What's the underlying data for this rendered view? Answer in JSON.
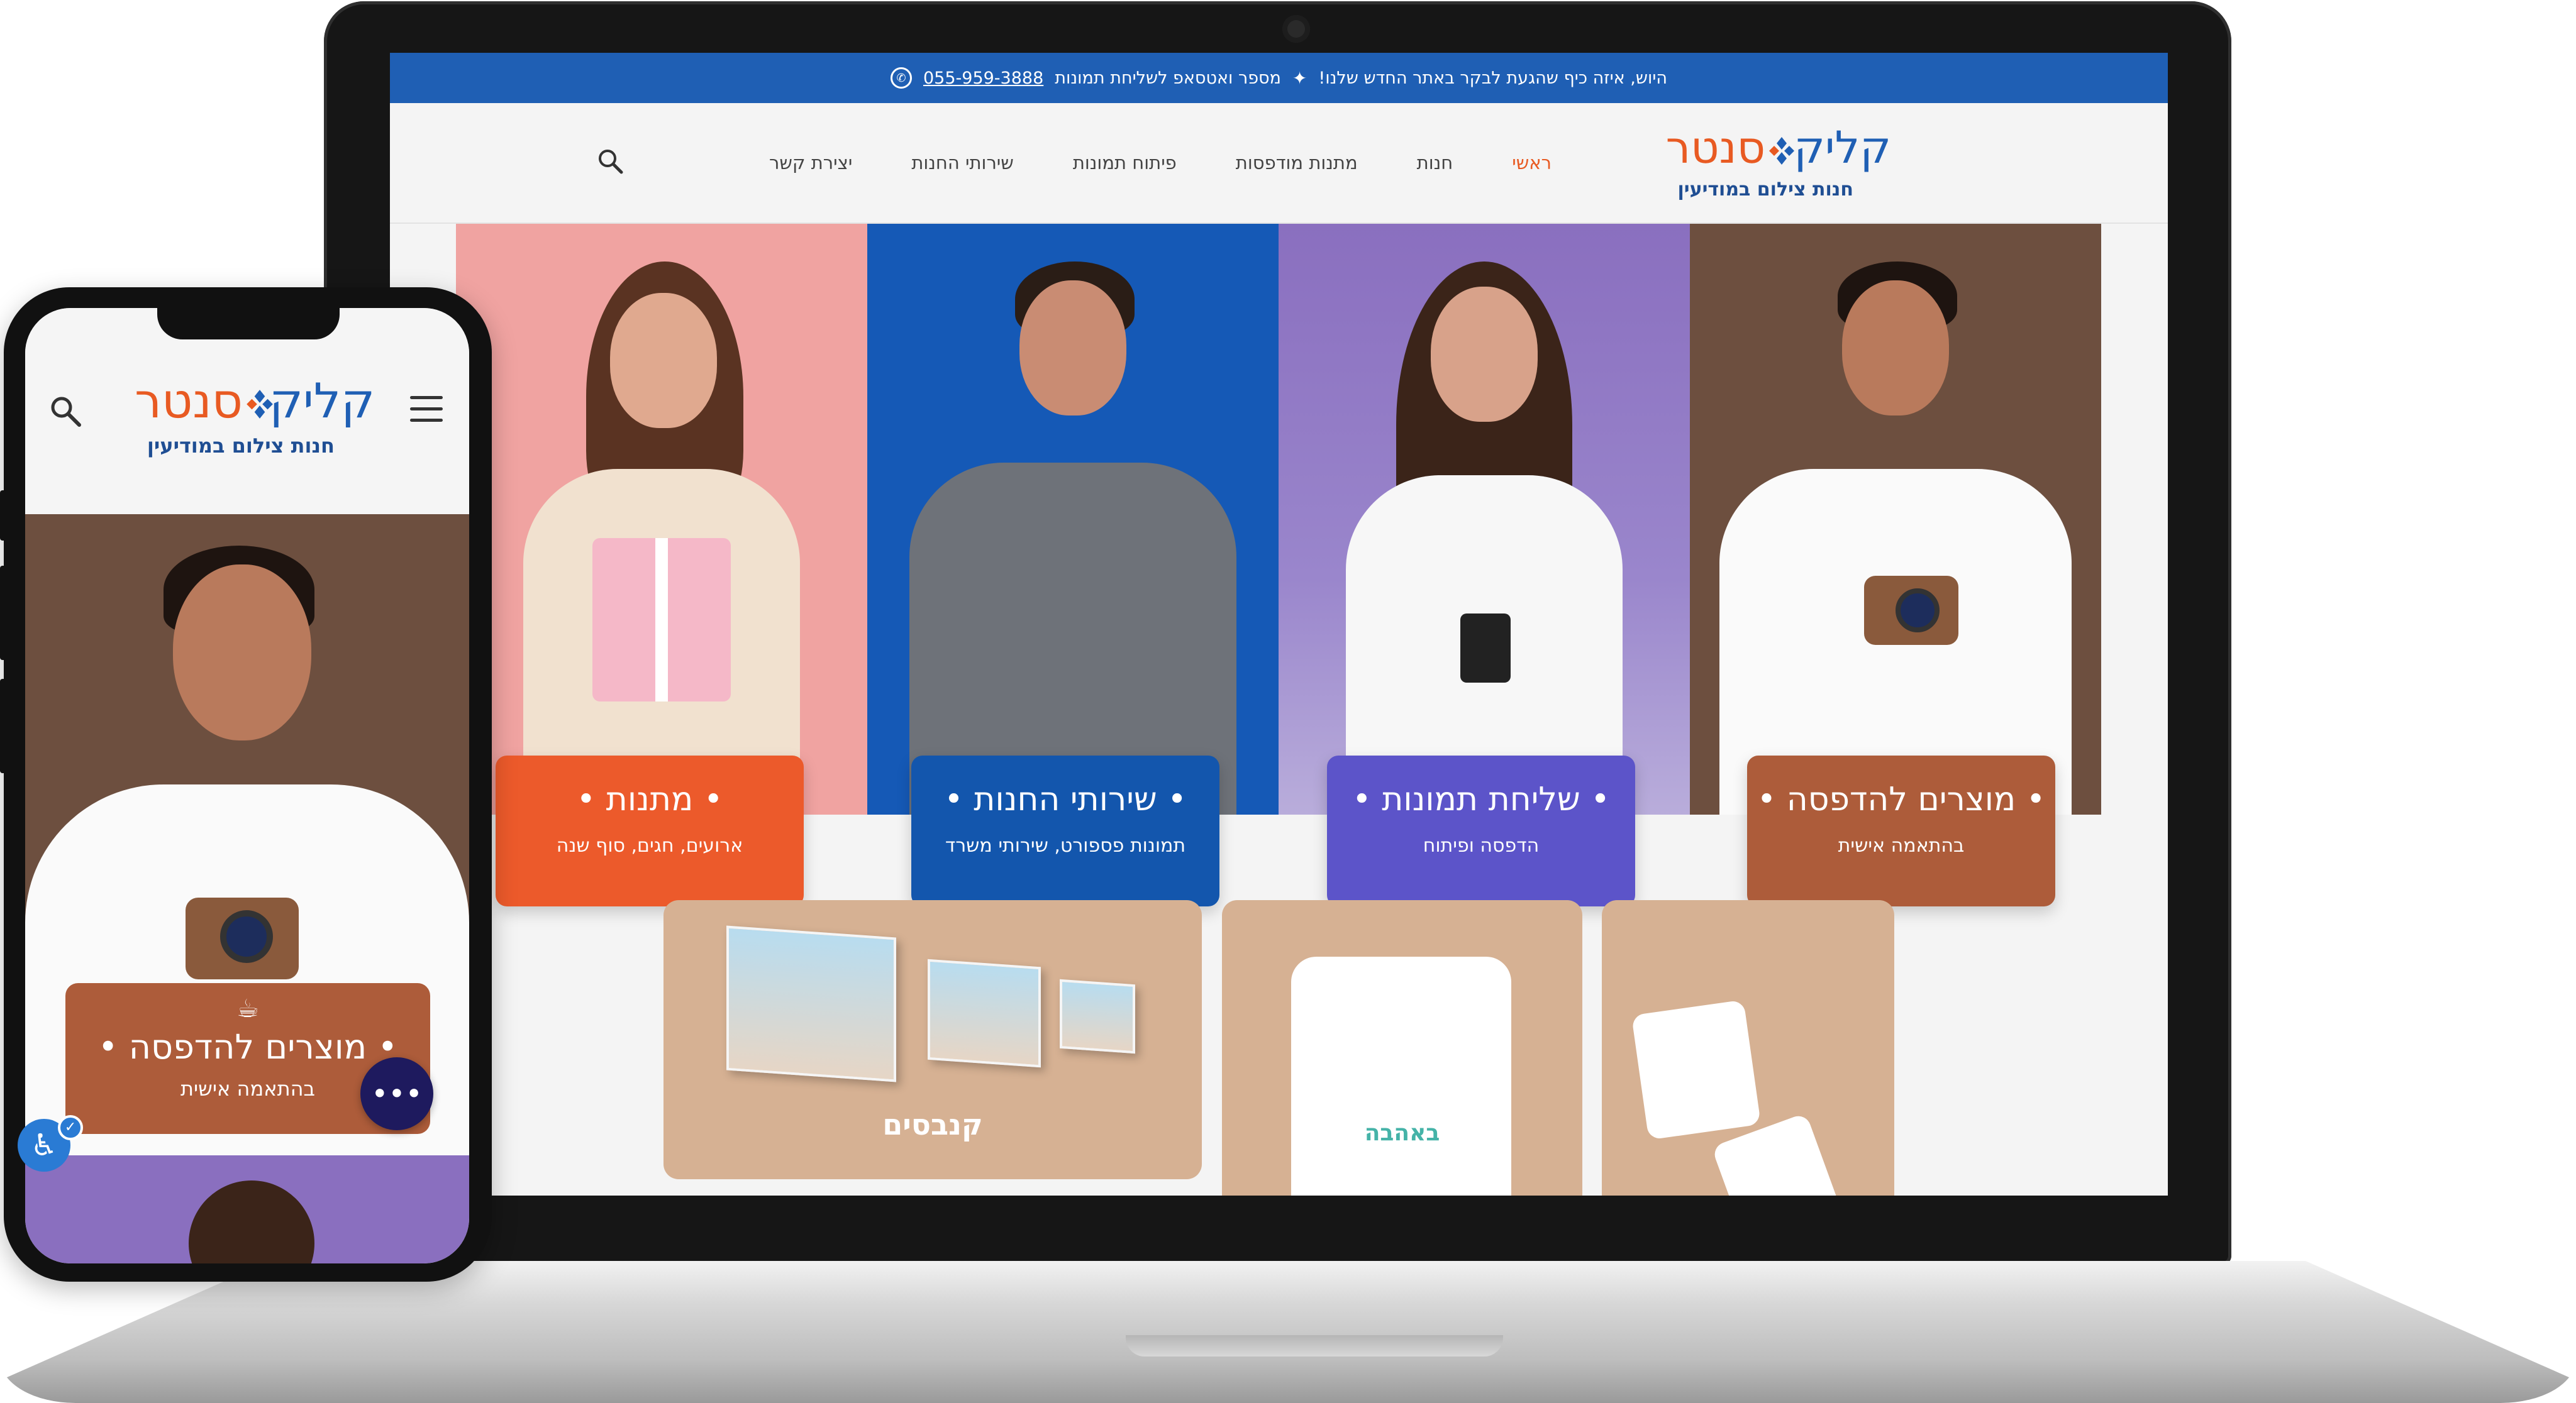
{
  "brand": {
    "name_part1": "קליק",
    "name_part2": "סנטר",
    "tagline": "חנות צילום במודיעין",
    "accent_orange": "#e85a22",
    "accent_blue": "#1f5fb4"
  },
  "topbar": {
    "message": "היוש, איזה כיף שהגעת לבקר באתר החדש שלנו!",
    "separator": "✦",
    "whatsapp_label": "מספר ואטסאפ לשליחת תמונות",
    "phone": "055-959-3888",
    "whatsapp_icon": "whatsapp-icon"
  },
  "nav": {
    "items": [
      "ראשי",
      "חנות",
      "מתנות מודפסות",
      "פיתוח תמונות",
      "שירותי החנות",
      "יצירת קשר"
    ],
    "active_index": 0,
    "search_icon": "search-icon"
  },
  "hero": {
    "cards": [
      {
        "title": "• מתנות •",
        "subtitle": "ארועים, חגים, סוף שנה",
        "color": "#ec5a2b"
      },
      {
        "title": "• שירותי החנות •",
        "subtitle": "תמונות פספורט, שירותי משרד",
        "color": "#1356ad"
      },
      {
        "title": "• שליחת תמונות •",
        "subtitle": "הדפסה ופיתוח",
        "color": "#5c54c9"
      },
      {
        "title": "• מוצרים להדפסה •",
        "subtitle": "בהתאמה אישית",
        "color": "#ad5c3a"
      }
    ]
  },
  "products": {
    "canvas_title": "קנבסים",
    "tshirt_text": "באהבה"
  },
  "mobile": {
    "menu_icon": "hamburger-icon",
    "search_icon": "search-icon",
    "hero_card": {
      "icon": "☕",
      "title": "• מוצרים להדפסה •",
      "subtitle": "בהתאמה אישית"
    },
    "more_button": "•••",
    "accessibility_icon": "♿",
    "check_icon": "✓"
  }
}
